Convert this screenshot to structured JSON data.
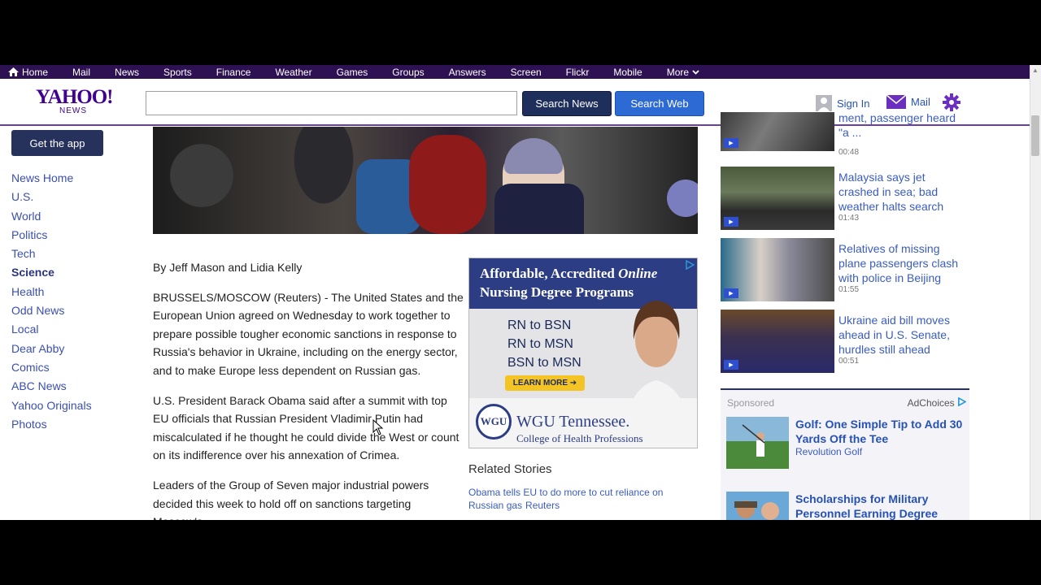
{
  "topnav": {
    "items": [
      "Home",
      "Mail",
      "News",
      "Sports",
      "Finance",
      "Weather",
      "Games",
      "Groups",
      "Answers",
      "Screen",
      "Flickr",
      "Mobile",
      "More"
    ]
  },
  "header": {
    "logo": "YAHOO!",
    "logo_sub": "NEWS",
    "search_value": "",
    "search_news_label": "Search News",
    "search_web_label": "Search Web",
    "sign_in_label": "Sign In",
    "mail_label": "Mail"
  },
  "sidebar": {
    "get_app_label": "Get the app",
    "items": [
      "News Home",
      "U.S.",
      "World",
      "Politics",
      "Tech",
      "Science",
      "Health",
      "Odd News",
      "Local",
      "Dear Abby",
      "Comics",
      "ABC News",
      "Yahoo Originals",
      "Photos"
    ],
    "active": "Science"
  },
  "article": {
    "byline": "By Jeff Mason and Lidia Kelly",
    "p1": "BRUSSELS/MOSCOW (Reuters) - The United States and the European Union agreed on Wednesday to work together to prepare possible tougher economic sanctions in response to Russia's behavior in Ukraine, including on the energy sector, and to make Europe less dependent on Russian gas.",
    "p2": "U.S. President Barack Obama said after a summit with top EU officials that Russian President Vladimir Putin had miscalculated if he thought he could divide the West or count on its indifference over his annexation of Crimea.",
    "p3": "Leaders of the Group of Seven major industrial powers decided this week to hold off on sanctions targeting Moscow's"
  },
  "ad": {
    "headline_1": "Affordable, Accredited",
    "headline_online": "Online",
    "headline_2": "Nursing Degree Programs",
    "programs": [
      "RN to BSN",
      "RN to MSN",
      "BSN to MSN"
    ],
    "cta": "LEARN MORE ➔",
    "seal": "WGU",
    "brand": "WGU Tennessee.",
    "brand_sub": "College of Health Professions"
  },
  "related": {
    "title": "Related Stories",
    "link": "Obama tells EU to do more to cut reliance on Russian gas",
    "source": "Reuters"
  },
  "videos": [
    {
      "title": "ment, passenger heard \"a ...",
      "duration": "00:48"
    },
    {
      "title": "Malaysia says jet crashed in sea; bad weather halts search",
      "duration": "01:43"
    },
    {
      "title": "Relatives of missing plane passengers clash with police in Beijing",
      "duration": "01:55"
    },
    {
      "title": "Ukraine aid bill moves ahead in U.S. Senate, hurdles still ahead",
      "duration": "00:51"
    }
  ],
  "sponsored": {
    "label": "Sponsored",
    "adchoices": "AdChoices",
    "items": [
      {
        "title": "Golf: One Simple Tip to Add 30 Yards Off the Tee",
        "source": "Revolution Golf"
      },
      {
        "title": "Scholarships for Military Personnel Earning Degree",
        "source": ""
      }
    ]
  },
  "colors": {
    "nav_bg": "#2d1152",
    "brand_purple": "#400090",
    "link_blue": "#3a5cc0",
    "search_news_bg": "#1e2f5c",
    "search_web_bg": "#2e6ad4"
  }
}
